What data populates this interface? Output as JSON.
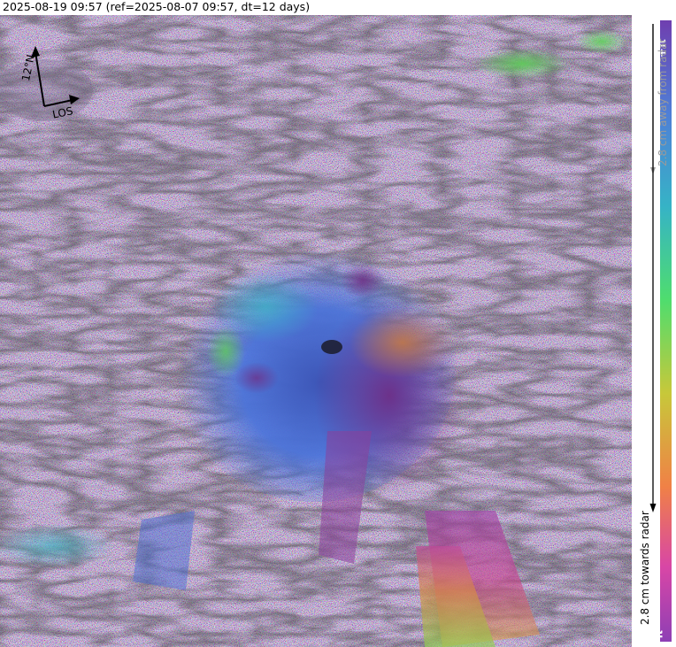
{
  "header": {
    "title": "2025-08-19 09:57 (ref=2025-08-07 09:57, dt=12 days)"
  },
  "compass": {
    "north_label": "12°N",
    "los_label": "LOS",
    "north_arrow_icon": "north-arrow",
    "los_arrow_icon": "los-arrow"
  },
  "legend": {
    "top_label": "+π",
    "bottom_label": "-π",
    "away_label": "2.8 cm away from radar",
    "towards_label": "2.8 cm towards radar",
    "colors": [
      "#6f3fb0",
      "#4f7fd6",
      "#36b3c6",
      "#4fdd6e",
      "#c7c83a",
      "#f08146",
      "#d846a6",
      "#8e3fb5"
    ]
  },
  "scene": {
    "colors": {
      "blue": "#4a6fd8",
      "purple": "#7b3b9e",
      "magenta": "#b0408f",
      "orange": "#d57f3f",
      "green": "#58c85a",
      "cyan": "#3fb4c8"
    }
  }
}
